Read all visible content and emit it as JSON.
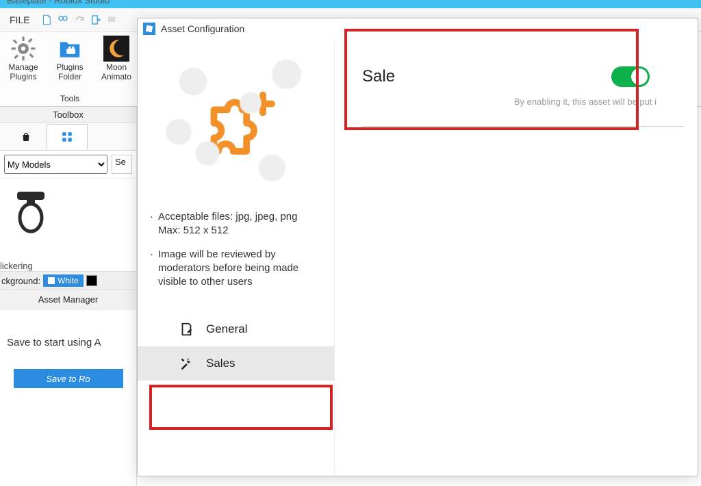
{
  "window": {
    "title": "Baseplate - Roblox Studio"
  },
  "menubar": {
    "file": "FILE"
  },
  "ribbon": {
    "group_caption": "Tools",
    "buttons": [
      {
        "label": "Manage Plugins",
        "icon": "gear"
      },
      {
        "label": "Plugins Folder",
        "icon": "folder"
      },
      {
        "label": "Moon Animato",
        "icon": "moon"
      }
    ]
  },
  "toolbox": {
    "header": "Toolbox",
    "dropdown": "My Models",
    "search_placeholder": "Se",
    "model_name": "lickering",
    "bg_label": "ckground:",
    "bg_value": "White"
  },
  "asset_manager": {
    "header": "Asset Manager",
    "message": "Save to start using A",
    "button": "Save to Ro"
  },
  "modal": {
    "title": "Asset Configuration",
    "notes": [
      "Acceptable files: jpg, jpeg, png Max: 512 x 512",
      "Image will be reviewed by moderators before being made visible to other users"
    ],
    "menu_general": "General",
    "menu_sales": "Sales",
    "sale_label": "Sale",
    "hint": "By enabling it, this asset will be put i"
  }
}
